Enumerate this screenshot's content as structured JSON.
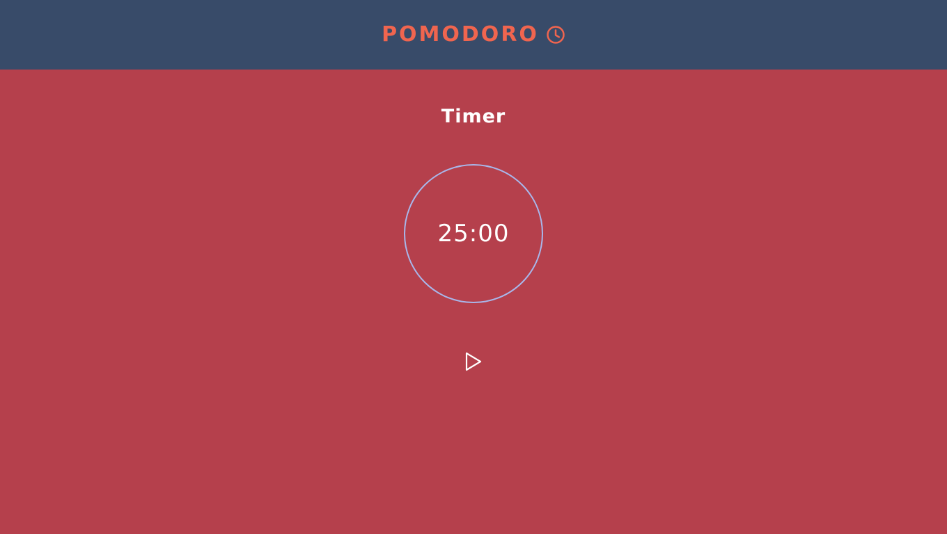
{
  "header": {
    "title": "POMODORO",
    "icon": "clock-icon",
    "accent_color": "#f0654f",
    "background_color": "#384b69"
  },
  "main": {
    "section_title": "Timer",
    "background_color": "#b5404c",
    "ring_color": "#a8b8ec",
    "timer": {
      "display": "25:00"
    },
    "controls": {
      "play_icon": "play-icon"
    }
  }
}
